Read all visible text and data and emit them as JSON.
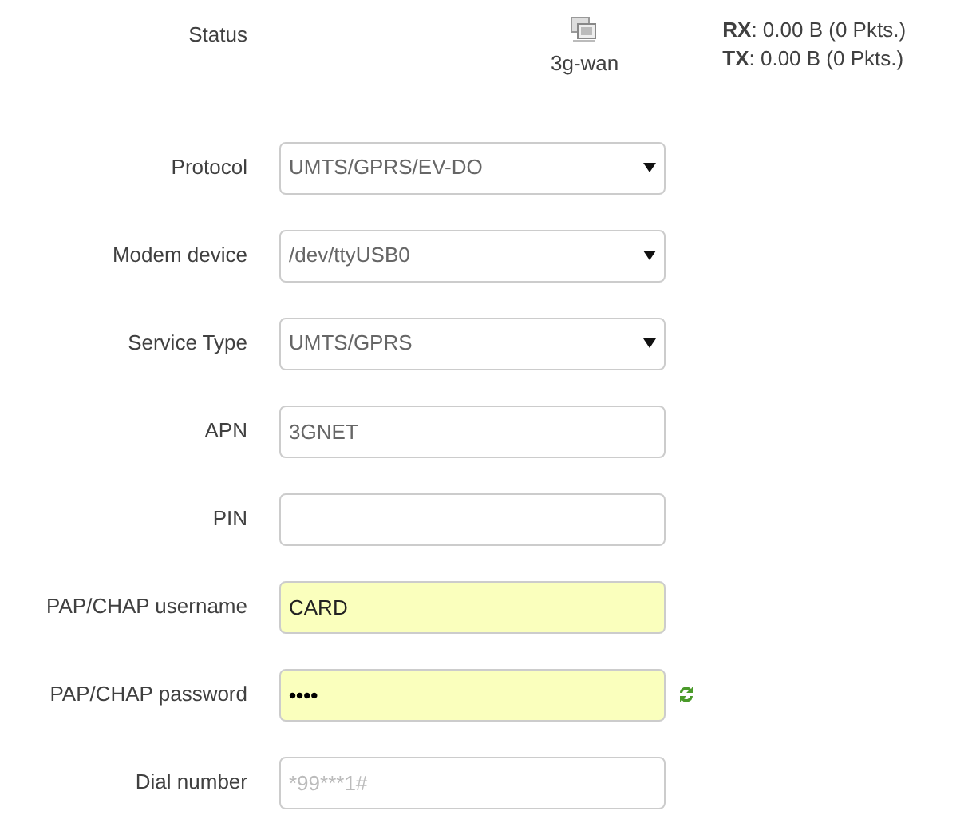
{
  "status": {
    "label": "Status",
    "interface": "3g-wan",
    "rx": {
      "key": "RX",
      "value": ": 0.00 B (0 Pkts.)"
    },
    "tx": {
      "key": "TX",
      "value": ": 0.00 B (0 Pkts.)"
    }
  },
  "fields": [
    {
      "label": "Protocol",
      "kind": "select",
      "value": "UMTS/GPRS/EV-DO",
      "autofilled": false
    },
    {
      "label": "Modem device",
      "kind": "select",
      "value": "/dev/ttyUSB0",
      "autofilled": false
    },
    {
      "label": "Service Type",
      "kind": "select",
      "value": "UMTS/GPRS",
      "autofilled": false
    },
    {
      "label": "APN",
      "kind": "text",
      "value": "3GNET",
      "autofilled": false
    },
    {
      "label": "PIN",
      "kind": "text",
      "autofilled": false
    },
    {
      "label": "PAP/CHAP username",
      "kind": "text",
      "value": "CARD",
      "autofilled": true
    },
    {
      "label": "PAP/CHAP password",
      "kind": "password",
      "value": "••••",
      "autofilled": true
    },
    {
      "label": "Dial number",
      "kind": "text",
      "placeholder": "*99***1#",
      "autofilled": false
    }
  ]
}
